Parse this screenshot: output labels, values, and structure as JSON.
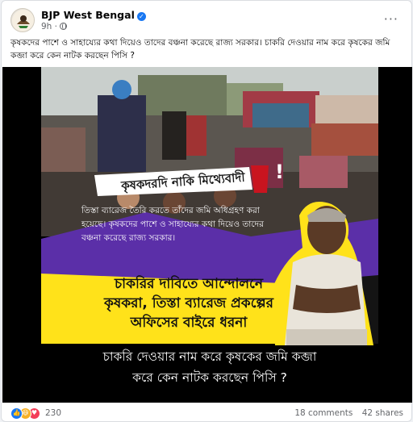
{
  "post": {
    "page_name": "BJP West Bengal",
    "time": "9h ·",
    "caption": "কৃষকদের পাশে ও সাহায্যের কথা দিয়েও তাদের বঞ্চনা করেছে রাজ্য সরকার। চাকরি দেওয়ার নাম করে কৃষকের জমি কব্জা করে কেন নাটক  করছেন পিসি ?"
  },
  "poster": {
    "badge": "কৃষকদরদি নাকি মিথ্যেবাদী",
    "badge_mark": "!",
    "body": "তিস্তা ব্যারেজ তৈরি করতে তাঁদের জমি অধিগ্রহণ করা হয়েছে। কৃষকদের পাশে ও সাহায্যের কথা দিয়েও তাদের বঞ্চনা করেছে রাজ্য সরকার।",
    "yellow_lines": [
      "চাকরির দাবিতে আন্দোলনে",
      "কৃষকরা, তিস্তা ব্যারেজ প্রকল্পের",
      "অফিসের বাইরে ধরনা"
    ],
    "bottom_lines": [
      "চাকরি দেওয়ার নাম করে কৃষকের জমি কব্জা",
      "করে কেন নাটক করছেন পিসি ?"
    ]
  },
  "stats": {
    "reactions": "230",
    "comments": "18 comments",
    "shares": "42 shares"
  },
  "colors": {
    "purple": "#5b2fa8",
    "yellow": "#ffe21a",
    "badge_red": "#c9141f",
    "link_blue": "#1877f2"
  },
  "icons": [
    "more-options-icon",
    "verified-badge-icon",
    "globe-icon",
    "like-reaction-icon",
    "haha-reaction-icon",
    "love-reaction-icon"
  ]
}
